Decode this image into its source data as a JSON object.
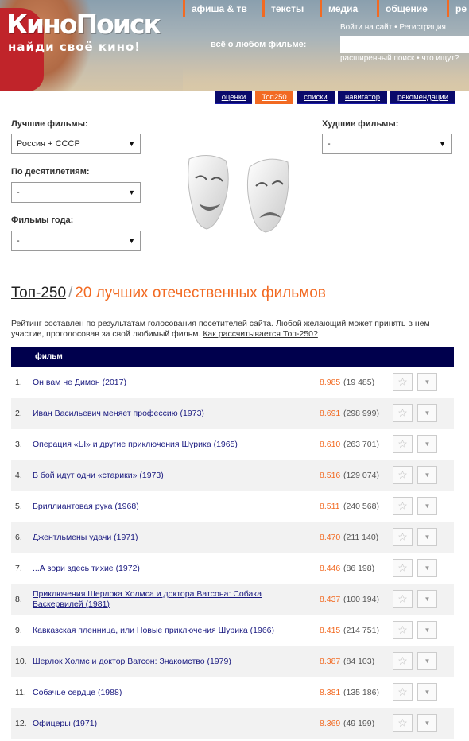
{
  "header": {
    "logo": "КиноПоиск",
    "tagline": "найди своё кино!",
    "nav": [
      "афиша & тв",
      "тексты",
      "медиа",
      "общение",
      "ре"
    ],
    "auth": {
      "login": "Войти на сайт",
      "sep": " • ",
      "register": "Регистрация"
    },
    "search_label": "всё о любом фильме:",
    "search_value": "",
    "adv": {
      "advanced": "расширенный поиск",
      "sep": " • ",
      "what": "что ищут?"
    }
  },
  "tabs": [
    "оценки",
    "Топ250",
    "списки",
    "навигатор",
    "рекомендации"
  ],
  "filters": {
    "best_label": "Лучшие фильмы:",
    "best_value": "Россия + СССР",
    "decades_label": "По десятилетиям:",
    "decades_value": "-",
    "year_label": "Фильмы года:",
    "year_value": "-",
    "worst_label": "Худшие фильмы:",
    "worst_value": "-"
  },
  "title": {
    "main": "Топ-250",
    "sep": "/",
    "sub": "20 лучших отечественных фильмов"
  },
  "description": {
    "text": "Рейтинг составлен по результатам голосования посетителей сайта. Любой желающий может принять в нем участие, проголосовав за свой любимый фильм. ",
    "link": "Как рассчитывается Топ-250?"
  },
  "table": {
    "header": "фильм",
    "rows": [
      {
        "num": "1.",
        "film": "Он вам не Димон (2017)",
        "rating": "8.985",
        "votes": "(19 485)"
      },
      {
        "num": "2.",
        "film": "Иван Васильевич меняет профессию (1973)",
        "rating": "8.691",
        "votes": "(298 999)"
      },
      {
        "num": "3.",
        "film": "Операция «Ы» и другие приключения Шурика (1965)",
        "rating": "8.610",
        "votes": "(263 701)"
      },
      {
        "num": "4.",
        "film": "В бой идут одни «старики» (1973)",
        "rating": "8.516",
        "votes": "(129 074)"
      },
      {
        "num": "5.",
        "film": "Бриллиантовая рука (1968)",
        "rating": "8.511",
        "votes": "(240 568)"
      },
      {
        "num": "6.",
        "film": "Джентльмены удачи (1971)",
        "rating": "8.470",
        "votes": "(211 140)"
      },
      {
        "num": "7.",
        "film": "...А зори здесь тихие (1972)",
        "rating": "8.446",
        "votes": "(86 198)"
      },
      {
        "num": "8.",
        "film": "Приключения Шерлока Холмса и доктора Ватсона: Собака Баскервилей (1981)",
        "rating": "8.437",
        "votes": "(100 194)"
      },
      {
        "num": "9.",
        "film": "Кавказская пленница, или Новые приключения Шурика (1966)",
        "rating": "8.415",
        "votes": "(214 751)"
      },
      {
        "num": "10.",
        "film": "Шерлок Холмс и доктор Ватсон: Знакомство (1979)",
        "rating": "8.387",
        "votes": "(84 103)"
      },
      {
        "num": "11.",
        "film": "Собачье сердце (1988)",
        "rating": "8.381",
        "votes": "(135 186)"
      },
      {
        "num": "12.",
        "film": "Офицеры (1971)",
        "rating": "8.369",
        "votes": "(49 199)"
      }
    ]
  },
  "icons": {
    "star": "star-icon",
    "dropdown": "chevron-down-icon"
  },
  "colors": {
    "accent": "#f26a22",
    "navy": "#00004d",
    "link": "#1a1a80"
  }
}
